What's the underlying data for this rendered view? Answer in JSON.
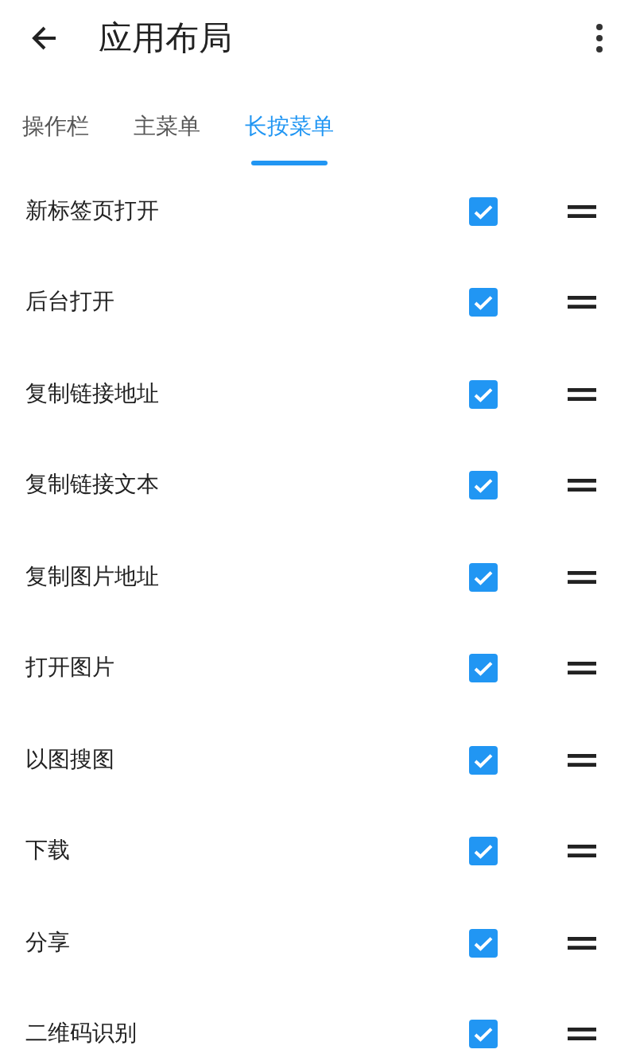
{
  "app_bar": {
    "title": "应用布局"
  },
  "tabs": [
    {
      "label": "操作栏",
      "selected": false
    },
    {
      "label": "主菜单",
      "selected": false
    },
    {
      "label": "长按菜单",
      "selected": true
    }
  ],
  "items": [
    {
      "label": "新标签页打开",
      "checked": true
    },
    {
      "label": "后台打开",
      "checked": true
    },
    {
      "label": "复制链接地址",
      "checked": true
    },
    {
      "label": "复制链接文本",
      "checked": true
    },
    {
      "label": "复制图片地址",
      "checked": true
    },
    {
      "label": "打开图片",
      "checked": true
    },
    {
      "label": "以图搜图",
      "checked": true
    },
    {
      "label": "下载",
      "checked": true
    },
    {
      "label": "分享",
      "checked": true
    },
    {
      "label": "二维码识别",
      "checked": true
    }
  ]
}
